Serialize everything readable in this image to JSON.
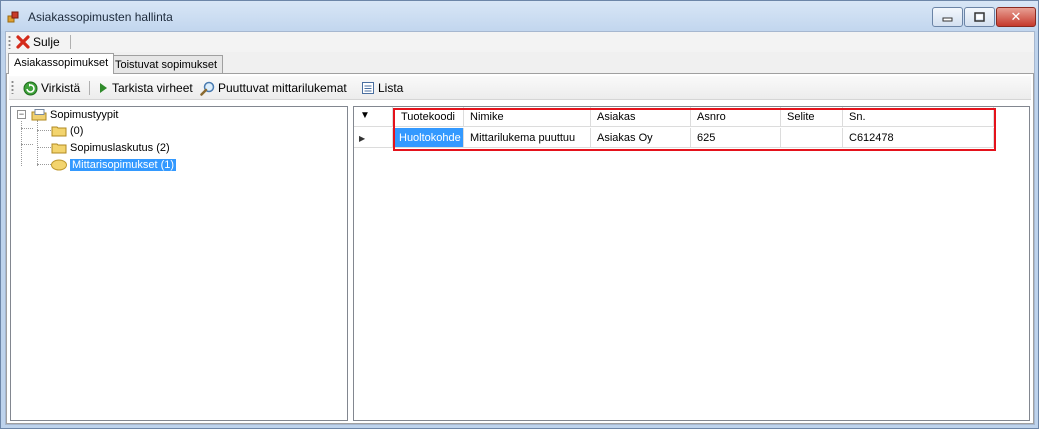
{
  "window": {
    "title": "Asiakassopimusten hallinta",
    "minimize_icon": "minimize-icon",
    "maximize_icon": "maximize-icon",
    "close_glyph": "✕"
  },
  "toolbar": {
    "close_label": "Sulje",
    "close_icon": "red-x-icon"
  },
  "tabs": [
    {
      "label": "Asiakassopimukset",
      "active": true
    },
    {
      "label": "Toistuvat sopimukset",
      "active": false
    }
  ],
  "actions": {
    "refresh_label": "Virkistä",
    "check_errors_label": "Tarkista virheet",
    "missing_readings_label": "Puuttuvat mittarilukemat",
    "list_label": "Lista"
  },
  "tree": {
    "root_label": "Sopimustyypit",
    "expander_glyph": "−",
    "children": [
      {
        "label": "(0)"
      },
      {
        "label": "Sopimuslaskutus (2)"
      },
      {
        "label": "Mittarisopimukset (1)",
        "selected": true
      }
    ]
  },
  "grid": {
    "row_header_glyph": "▶",
    "filter_glyph": "▼",
    "columns": [
      "Tuotekoodi",
      "Nimike",
      "Asiakas",
      "Asnro",
      "Selite",
      "Sn."
    ],
    "rows": [
      [
        "Huoltokohde",
        "Mittarilukema puuttuu",
        "Asiakas Oy",
        "625",
        "",
        "C612478"
      ]
    ]
  },
  "colors": {
    "selection": "#3399ff",
    "highlight_border": "#e4121b"
  }
}
